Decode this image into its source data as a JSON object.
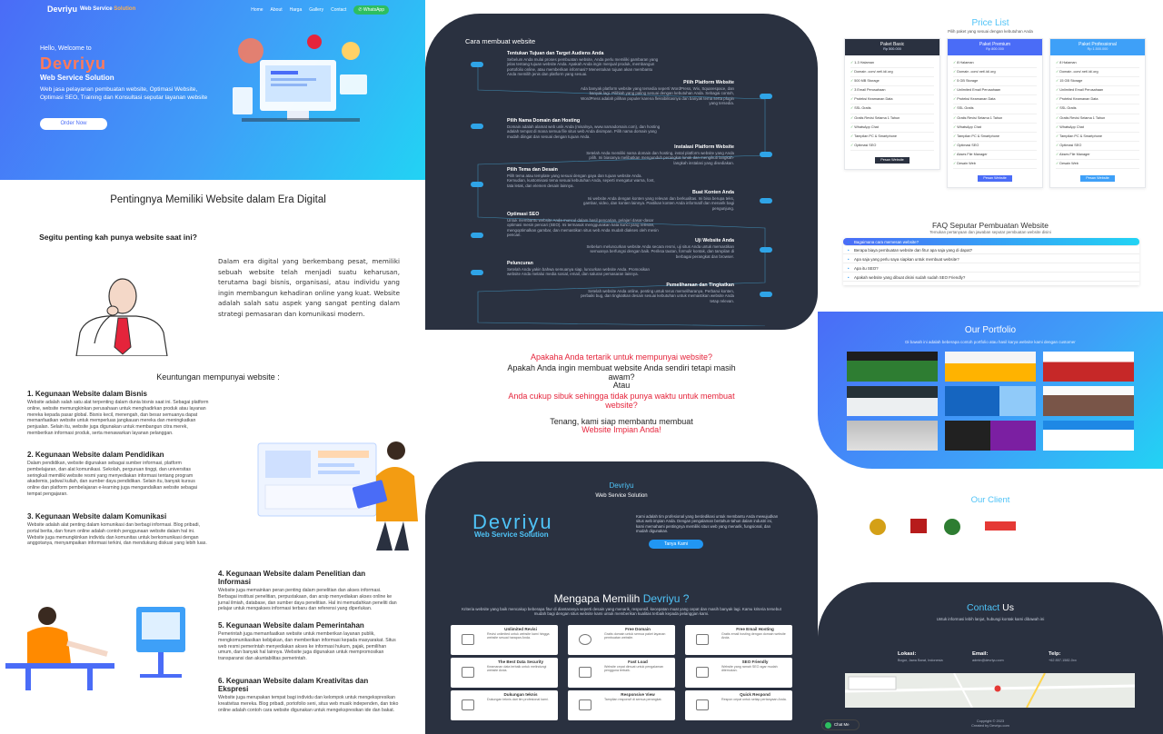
{
  "nav": {
    "brand": "Devriyu",
    "brand_tag": "Web Service",
    "brand_tag_accent": "Solution",
    "links": [
      "Home",
      "About",
      "Harga",
      "Gallery",
      "Contact"
    ],
    "whatsapp": "WhatsApp"
  },
  "hero": {
    "hello": "Hello, Welcome to",
    "title": "Devriyu",
    "subtitle": "Web Service Solution",
    "description": "Web jasa pelayanan pembuatan website, Optimasi Website, Optimasi SEO, Training dan Konsultasi seputar layanan website",
    "order_button": "Order Now"
  },
  "importance": {
    "title": "Pentingnya Memiliki Website dalam Era Digital",
    "question": "Segitu penting kah punya website saat ini?",
    "text": "Dalam era digital yang berkembang pesat, memiliki sebuah website telah menjadi suatu keharusan, terutama bagi bisnis, organisasi, atau individu yang ingin membangun kehadiran online yang kuat. Website adalah salah satu aspek yang sangat penting dalam strategi pemasaran dan komunikasi modern."
  },
  "benefits": {
    "title": "Keuntungan mempunyai website :",
    "items": [
      {
        "h": "1. Kegunaan Website dalam Bisnis",
        "p": "Website adalah salah satu alat terpenting dalam dunia bisnis saat ini. Sebagai platform online, website memungkinkan perusahaan untuk menghadirkan produk atau layanan mereka kepada pasar global. Bisnis kecil, menengah, dan besar semuanya dapat memanfaatkan website untuk memperluas jangkauan mereka dan meningkatkan penjualan. Selain itu, website juga digunakan untuk membangun citra merek, memberikan informasi produk, serta menawarkan layanan pelanggan."
      },
      {
        "h": "2. Kegunaan Website dalam Pendidikan",
        "p": "Dalam pendidikan, website digunakan sebagai sumber informasi, platform pembelajaran, dan alat komunikasi. Sekolah, perguruan tinggi, dan universitas seringkali memiliki website resmi yang menyediakan informasi tentang program akademis, jadwal kuliah, dan sumber daya pendidikan. Selain itu, banyak kursus online dan platform pembelajaran e-learning juga mengandalkan website sebagai tempat pengajaran."
      },
      {
        "h": "3. Kegunaan Website dalam Komunikasi",
        "p": "Website adalah alat penting dalam komunikasi dan berbagi informasi. Blog pribadi, portal berita, dan forum online adalah contoh penggunaan website dalam hal ini. Website juga memungkinkan individu dan komunitas untuk berkomunikasi dengan anggotanya, menyampaikan informasi terkini, dan mendukung diskusi yang lebih luas."
      },
      {
        "h": "4. Kegunaan Website dalam Penelitian dan Informasi",
        "p": "Website juga memainkan peran penting dalam penelitian dan akses informasi. Berbagai institusi penelitian, perpustakaan, dan arsip menyediakan akses online ke jurnal ilmiah, database, dan sumber daya penelitian. Hal ini memudahkan peneliti dan pelajar untuk mengakses informasi terbaru dan referensi yang diperlukan."
      },
      {
        "h": "5. Kegunaan Website dalam Pemerintahan",
        "p": "Pemerintah juga memanfaatkan website untuk memberikan layanan publik, mengkomunikasikan kebijakan, dan memberikan informasi kepada masyarakat. Situs web resmi pemerintah menyediakan akses ke informasi hukum, pajak, pemilihan umum, dan banyak hal lainnya. Website juga digunakan untuk mempromosikan transparansi dan akuntabilitas pemerintah."
      },
      {
        "h": "6. Kegunaan Website dalam Kreativitas dan Ekspresi",
        "p": "Website juga merupakan tempat bagi individu dan kelompok untuk mengekspresikan kreativitas mereka. Blog pribadi, portofolio seni, situs web musik independen, dan toko online adalah contoh cara website digunakan untuk mengekspresikan ide dan bakat."
      }
    ]
  },
  "steps": {
    "title": "Cara membuat website",
    "items": [
      {
        "h": "Tentukan Tujuan dan Target Audiens Anda",
        "p": "Sebelum Anda mulai proses pembuatan website, Anda perlu memiliki gambaran yang jelas tentang tujuan website Anda. Apakah Anda ingin menjual produk, membangun portofolio online, atau memberikan informasi? Menentukan tujuan akan membantu Anda memilih jenis dan platform yang sesuai."
      },
      {
        "h": "Pilih Platform Website",
        "p": "Ada banyak platform website yang tersedia seperti WordPress, Wix, Squarespace, dan banyak lagi. Pilihlah yang paling sesuai dengan kebutuhan Anda. Sebagai contoh, WordPress adalah pilihan populer karena fleksibilitasnya dan banyak tema serta plugin yang tersedia."
      },
      {
        "h": "Pilih Nama Domain dan Hosting",
        "p": "Domain adalah alamat web unik Anda (misalnya, www.namadomain.com), dan hosting adalah tempat di mana semua file situs web Anda disimpan. Pilih nama domain yang mudah diingat dan sesuai dengan tujuan Anda."
      },
      {
        "h": "Instalasi Platform Website",
        "p": "Setelah Anda memiliki nama domain dan hosting, instal platform website yang Anda pilih. Ini biasanya melibatkan mengunduh perangkat lunak dan mengikuti langkah-langkah instalasi yang disediakan."
      },
      {
        "h": "Pilih Tema dan Desain",
        "p": "Pilih tema atau template yang sesuai dengan gaya dan tujuan website Anda. Kemudian, kustomisasi tema sesuai kebutuhan Anda, seperti mengatur warna, font, tata letak, dan elemen desain lainnya."
      },
      {
        "h": "Buat Konten Anda",
        "p": "Isi website Anda dengan konten yang relevan dan berkualitas. Ini bisa berupa teks, gambar, video, dan konten lainnya. Pastikan konten Anda informatif dan menarik bagi pengunjung."
      },
      {
        "h": "Optimasi SEO",
        "p": "Untuk membantu website Anda muncul dalam hasil pencarian, pelajari dasar-dasar optimasi mesin pencari (SEO). Ini termasuk menggunakan kata kunci yang relevan, mengoptimalkan gambar, dan memastikan situs web Anda mudah diakses oleh mesin pencari."
      },
      {
        "h": "Uji Website Anda",
        "p": "Sebelum meluncurkan website Anda secara resmi, uji situs Anda untuk memastikan semuanya berfungsi dengan baik. Periksa tautan, formulir kontak, dan tampilan di berbagai perangkat dan browser."
      },
      {
        "h": "Peluncuran",
        "p": "Setelah Anda yakin bahwa semuanya siap, luncurkan website Anda. Promosikan website Anda melalui media sosial, email, dan saluran pemasaran lainnya."
      },
      {
        "h": "Pemeliharaan dan Tingkatkan",
        "p": "Setelah website Anda online, penting untuk terus memeliharanya. Perbarui konten, perbaiki bug, dan tingkatkan desain sesuai kebutuhan untuk memastikan website Anda tetap relevan."
      }
    ]
  },
  "middle": {
    "q1": "Apakaha Anda tertarik untuk mempunyai website?",
    "q2": "Apakah Anda ingin membuat website Anda sendiri tetapi masih awam?",
    "or": "Atau",
    "q3": "Anda cukup sibuk sehingga tidak punya waktu untuk membuat website?",
    "a1": "Tenang, kami siap membantu membuat",
    "a2": "Website Impian Anda!"
  },
  "devriyu": {
    "name": "Devriyu",
    "sub": "Web Service Solution",
    "logo": "Devriyu",
    "logo_sub": "Web Service Solution",
    "desc": "Kami adalah tim profesional yang berdedikasi untuk membantu Anda mewujudkan situs web impian Anda. Dengan pengalaman bertahun-tahun dalam industri ini, kami memahami pentingnya memiliki situs web yang menarik, fungsional, dan mudah digunakan.",
    "button": "Tanya Kami"
  },
  "why": {
    "title": "Mengapa Memilih",
    "title_accent": "Devriyu ?",
    "desc": "Kriteria website yang baik mencakup beberapa fitur di diantaranya seperti desain yang menarik, responsif, kecepatan muat yang cepat dan masih banyak lagi. Kamu kriteria tersebut mudah bagi dengan situs website kami untuk memberikan kualitas terbaik kepada pelanggan kami.",
    "features": [
      {
        "h": "Unlimited Revisi",
        "p": "Revisi unlimited untuk website kami hingga website sesuai harapan Anda."
      },
      {
        "h": "Free Domain",
        "p": "Gratis domain untuk semua paket layanan pembuatan website."
      },
      {
        "h": "Free Email Hosting",
        "p": "Gratis email hosting dengan domain website Anda."
      },
      {
        "h": "The Best Data Security",
        "p": "Keamanan data terbaik untuk melindungi website Anda."
      },
      {
        "h": "Fast Load",
        "p": "Website cepat dimuat untuk pengalaman pengguna terbaik."
      },
      {
        "h": "SEO Friendly",
        "p": "Website yang ramah SEO agar mudah ditemukan."
      },
      {
        "h": "Dukungan teknis",
        "p": "Dukungan teknis dari tim profesional kami."
      },
      {
        "h": "Responsive View",
        "p": "Tampilan responsif di semua perangkat."
      },
      {
        "h": "Quick Respond",
        "p": "Respon cepat untuk setiap pertanyaan Anda."
      }
    ]
  },
  "pricing": {
    "title": "Price List",
    "sub": "Pilih paket yang sesuai dengan kebutuhan Anda",
    "plans": [
      {
        "name": "Paket Basic",
        "price": "Rp 500.000",
        "button": "Pesan Website",
        "features": [
          "1-3 Halaman",
          "Domain .com/.net/.id/.org",
          "500 MB Storage",
          "3 Email Perusahaan",
          "Proteksi Keamanan Data",
          "SSL Gratis",
          "Gratis Revisi Selama 1 Tahun",
          "WhatsApp Chat",
          "Tampilan PC & Smartphone",
          "Optimasi SEO"
        ]
      },
      {
        "name": "Paket Premium",
        "price": "Rp 800.000",
        "button": "Pesan Website",
        "features": [
          "8 Halaman",
          "Domain .com/.net/.id/.org",
          "5 GB Storage",
          "Unlimited Email Perusahaan",
          "Proteksi Keamanan Data",
          "SSL Gratis",
          "Gratis Revisi Selama 1 Tahun",
          "WhatsApp Chat",
          "Tampilan PC & Smartphone",
          "Optimasi SEO",
          "Akses File Manager",
          "Desain Web"
        ]
      },
      {
        "name": "Paket Professional",
        "price": "Rp 1.500.000",
        "button": "Pesan Website",
        "features": [
          "8 Halaman",
          "Domain .com/.net/.id/.org",
          "15 GB Storage",
          "Unlimited Email Perusahaan",
          "Proteksi Keamanan Data",
          "SSL Gratis",
          "Gratis Revisi Selama 1 Tahun",
          "WhatsApp Chat",
          "Tampilan PC & Smartphone",
          "Optimasi SEO",
          "Akses File Manager",
          "Desain Web"
        ]
      }
    ]
  },
  "faq": {
    "title": "FAQ Seputar Pembuatan Website",
    "sub": "Temukan pertanyaan dan jawaban seputar pembuatan website disini",
    "items": [
      "Bagaimana cara memesan website?",
      "Berapa biaya pembuatan website dan fitur apa saja yang di dapat?",
      "Apa saja yang perlu saya siapkan untuk membuat website?",
      "Apa itu SEO?",
      "Apakah website yang dibuat disini sudah sudah SEO Friendly?"
    ]
  },
  "portfolio": {
    "title": "Our Portfolio",
    "sub": "Di bawah ini adalah beberapa contoh portfolio atau hasil karya website kami dengan customer"
  },
  "clients": {
    "title": "Our Client"
  },
  "contact": {
    "title": "Contact",
    "title_accent": "Us",
    "sub": "Untuk informasi lebih lanjut, hubungi kontak kami dibawah ini",
    "lokasi_label": "Lokasi:",
    "lokasi_val": "Bogor, Jawa Barat, Indonesia",
    "email_label": "Email:",
    "email_val": "admin@devriyu.com",
    "telp_label": "Telp:",
    "telp_val": "+62 857-1582-0xx",
    "copyright": "Copyright © 2023",
    "created": "Created by Devriyu.com",
    "chat": "Chat Me"
  },
  "colors": {
    "accent": "#4fc3f7",
    "dark": "#2a3140",
    "blue": "#4a6cf7",
    "red": "#e5243b",
    "orange": "#ff7a59"
  }
}
